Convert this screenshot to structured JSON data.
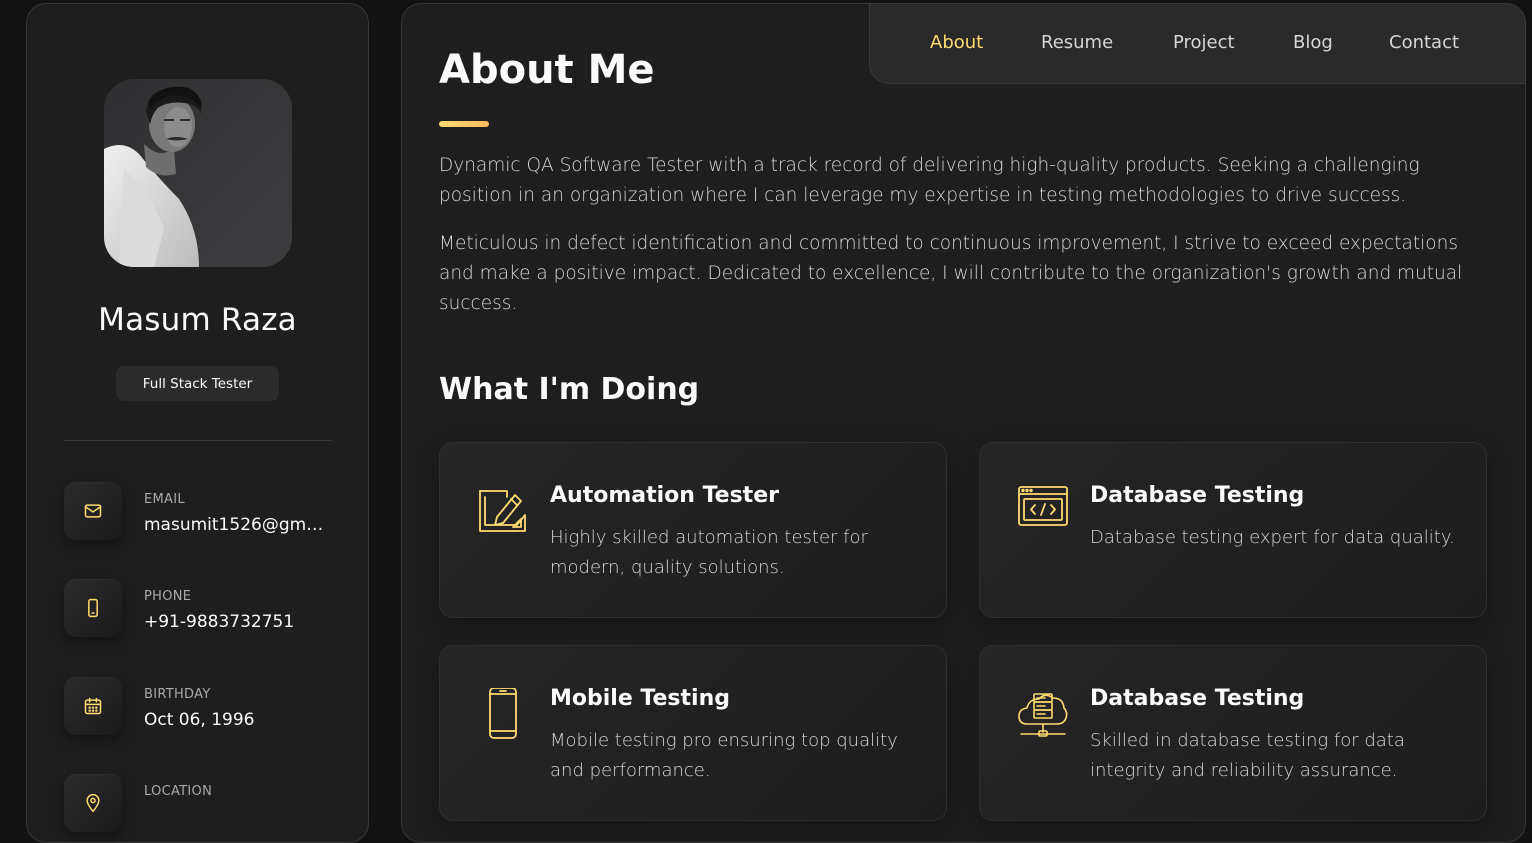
{
  "accent_color": "#ffdb70",
  "profile": {
    "name": "Masum Raza",
    "title": "Full Stack Tester",
    "avatar_icon": "profile-photo"
  },
  "contacts": [
    {
      "label": "EMAIL",
      "value": "masumit1526@gma...",
      "icon": "mail-icon"
    },
    {
      "label": "PHONE",
      "value": "+91-9883732751",
      "icon": "phone-icon"
    },
    {
      "label": "BIRTHDAY",
      "value": "Oct 06, 1996",
      "icon": "calendar-icon"
    },
    {
      "label": "LOCATION",
      "value": "",
      "icon": "location-pin-icon"
    }
  ],
  "nav": {
    "items": [
      "About",
      "Resume",
      "Project",
      "Blog",
      "Contact"
    ],
    "active": "About"
  },
  "about": {
    "title": "About Me",
    "paragraphs": [
      "Dynamic QA Software Tester with a track record of delivering high-quality products. Seeking a challenging position in an organization where I can leverage my expertise in testing methodologies to drive success.",
      "Meticulous in defect identification and committed to continuous improvement, I strive to exceed expectations and make a positive impact. Dedicated to excellence, I will contribute to the organization's growth and mutual success."
    ]
  },
  "services": {
    "title": "What I'm Doing",
    "items": [
      {
        "title": "Automation Tester",
        "text": "Highly skilled automation tester for modern, quality solutions.",
        "icon": "design-tools-icon"
      },
      {
        "title": "Database Testing",
        "text": "Database testing expert for data quality.",
        "icon": "code-window-icon"
      },
      {
        "title": "Mobile Testing",
        "text": "Mobile testing pro ensuring top quality and performance.",
        "icon": "smartphone-icon"
      },
      {
        "title": "Database Testing",
        "text": "Skilled in database testing for data integrity and reliability assurance.",
        "icon": "cloud-server-icon"
      }
    ]
  }
}
